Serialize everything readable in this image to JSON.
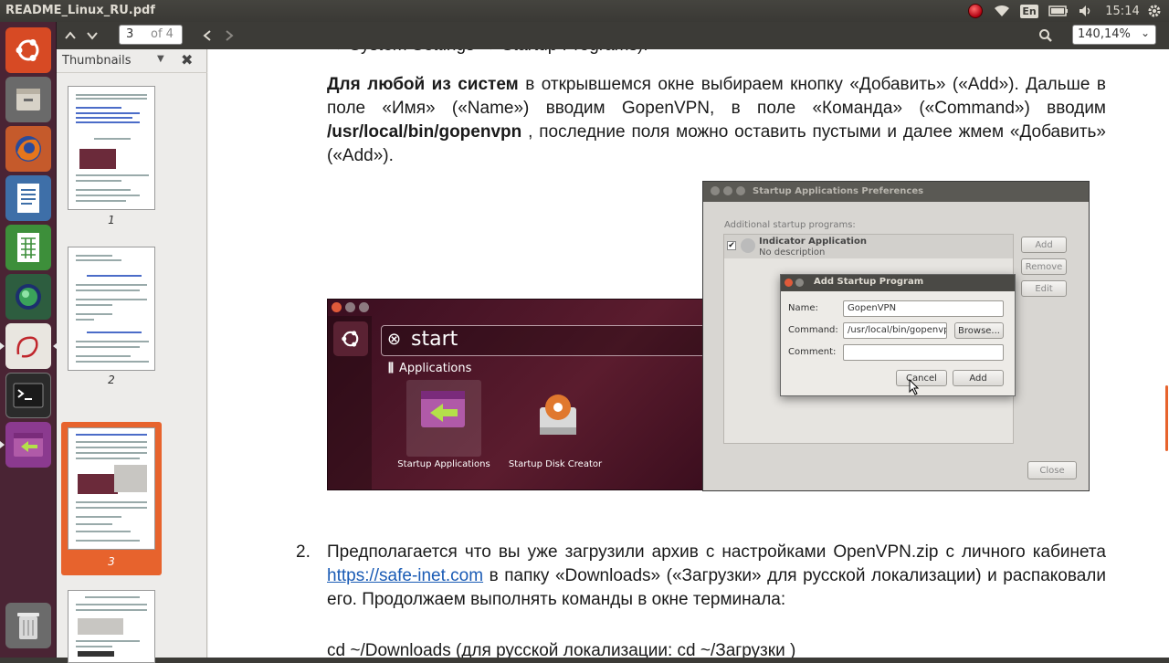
{
  "window": {
    "title": "README_Linux_RU.pdf"
  },
  "tray": {
    "language": "En",
    "clock": "15:14"
  },
  "toolbar": {
    "current_page": "3",
    "page_count": "of 4",
    "zoom": "140,14%"
  },
  "sidebar": {
    "title": "Thumbnails",
    "pages": [
      "1",
      "2",
      "3"
    ]
  },
  "document": {
    "line_top": "→ System Settings → Startup Programs).",
    "p1_bold": "Для любой из систем",
    "p1_a": " в открывшемся окне выбираем кнопку «Добавить» («Add»). Дальше в поле «Имя» («Name») вводим GopenVPN, в поле «Команда» («Command») вводим ",
    "p1_cmd": "/usr/local/bin/gopenvpn",
    "p1_b": " , последние поля можно оставить пустыми и далее жмем «Добавить» («Add»).",
    "item2_number": "2.",
    "p2_a": "Предполагается что вы уже загрузили архив с настройками OpenVPN.zip с личного кабинета ",
    "p2_link": "https://safe-inet.com",
    "p2_b": " в папку «Downloads» («Загрузки» для русской локализации) и распаковали его. Продолжаем выполнять команды в окне терминала:",
    "cmd_line": "cd ~/Downloads  (для русской локализации: cd ~/Загрузки  )"
  },
  "dash": {
    "search_text": "start",
    "section": "Applications",
    "app1": "Startup Applications",
    "app2": "Startup Disk Creator"
  },
  "prefs": {
    "title": "Startup Applications Preferences",
    "list_label": "Additional startup programs:",
    "item_name": "Indicator Application",
    "item_desc": "No description",
    "add": "Add",
    "remove": "Remove",
    "edit": "Edit",
    "close": "Close"
  },
  "add_dialog": {
    "title": "Add Startup Program",
    "name_label": "Name:",
    "name_value": "GopenVPN",
    "command_label": "Command:",
    "command_value": "/usr/local/bin/gopenvpn",
    "browse": "Browse...",
    "comment_label": "Comment:",
    "cancel": "Cancel",
    "add": "Add"
  },
  "colors": {
    "launcher": "#4a2434",
    "accent": "#e7632d",
    "link": "#1a5bb5"
  }
}
